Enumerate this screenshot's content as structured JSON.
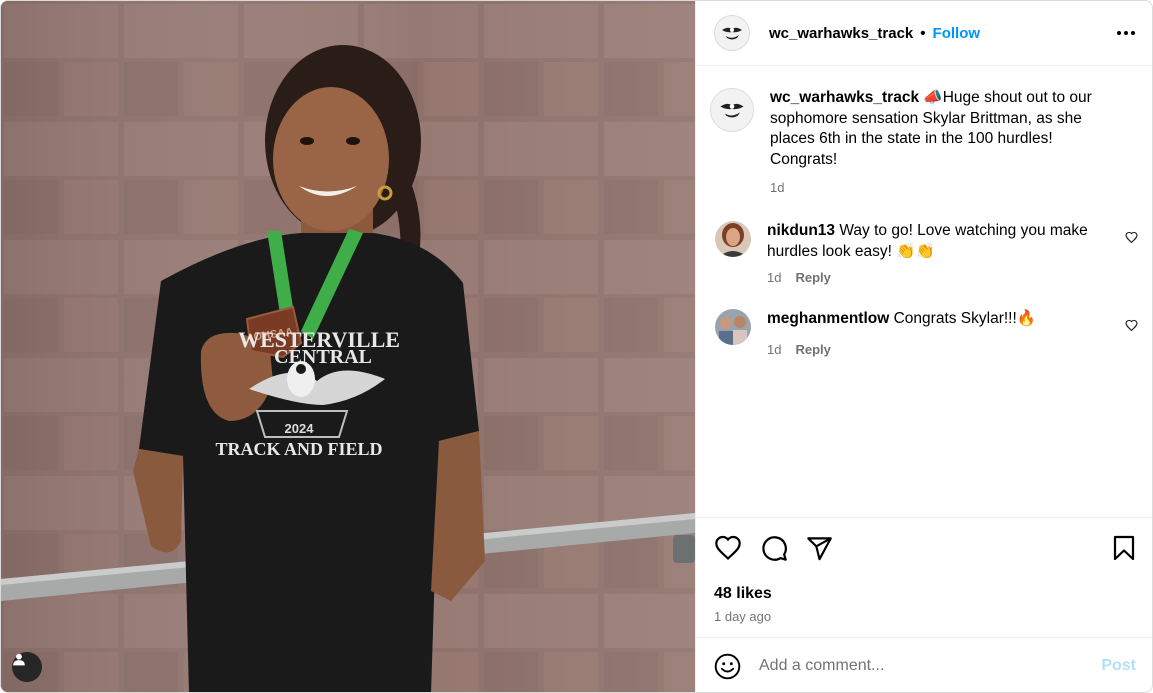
{
  "header": {
    "username": "wc_warhawks_track",
    "separator": "•",
    "follow_label": "Follow"
  },
  "caption": {
    "username": "wc_warhawks_track",
    "emoji": "📣",
    "text": "Huge shout out to our sophomore sensation Skylar Brittman, as she places 6th in the state in the 100 hurdles! Congrats!",
    "time": "1d"
  },
  "comments": [
    {
      "username": "nikdun13",
      "text": "Way to go! Love watching you make hurdles look easy! 👏👏",
      "time": "1d",
      "reply_label": "Reply"
    },
    {
      "username": "meghanmentlow",
      "text": "Congrats Skylar!!!🔥",
      "time": "1d",
      "reply_label": "Reply"
    }
  ],
  "photo": {
    "shirt_line1": "WESTERVILLE",
    "shirt_line2": "CENTRAL",
    "shirt_year": "2024",
    "shirt_line3": "TRACK AND FIELD",
    "medal_text": "OHSAA"
  },
  "engagement": {
    "likes": "48 likes",
    "time_ago": "1 day ago"
  },
  "add_comment": {
    "placeholder": "Add a comment...",
    "post_label": "Post"
  },
  "icons": {
    "like": "heart-icon",
    "comment": "comment-bubble-icon",
    "share": "paper-plane-icon",
    "save": "bookmark-icon",
    "emoji": "smiley-icon",
    "more": "more-dots-icon",
    "user_tag": "user-tag-icon"
  },
  "colors": {
    "link_blue": "#0095f6",
    "post_disabled": "#b2dffc",
    "muted": "#737373"
  }
}
